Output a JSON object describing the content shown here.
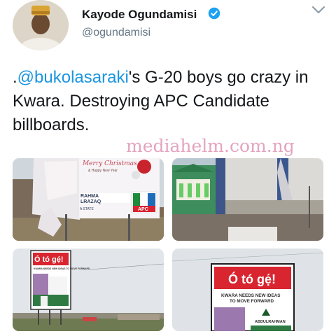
{
  "user": {
    "display_name": "Kayode Ogundamisi",
    "handle": "@ogundamisi",
    "verified": true,
    "avatar_icon": "profile-photo"
  },
  "tweet": {
    "prefix": ".",
    "mention": "@bukolasaraki",
    "text": "'s G-20 boys go crazy in Kwara.  Destroying APC Candidate billboards.",
    "mention_color": "#1b95e0"
  },
  "watermark": "mediahelm.com.ng",
  "photos": {
    "photo1": {
      "greeting": "Merry Christmas",
      "sub": "& Happy New Year",
      "name": "RAHMA",
      "name2": "LRAZAQ",
      "state": "A STATE",
      "party": "APC"
    },
    "photo3": {
      "headline": "Ó tó gẹ́!",
      "slogan": "KWARA NEEDS NEW IDEAS TO MOVE FORWARD"
    },
    "photo4": {
      "headline": "Ó tó gẹ́!",
      "slogan1": "KWARA NEEDS NEW IDEAS",
      "slogan2": "TO MOVE FORWARD",
      "name": "ABDULRAHMAN"
    }
  },
  "colors": {
    "text": "#14171a",
    "secondary": "#657786",
    "verified": "#1da1f2"
  },
  "icons": [
    "verified-badge-icon",
    "chevron-down-icon"
  ]
}
